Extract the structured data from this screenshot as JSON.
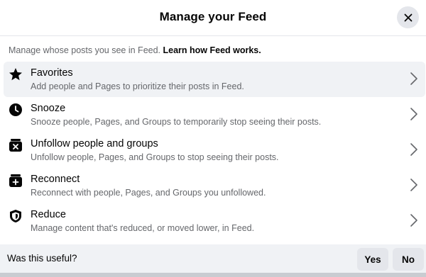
{
  "header": {
    "title": "Manage your Feed",
    "close_icon": "close-icon"
  },
  "intro": {
    "text": "Manage whose posts you see in Feed. ",
    "link": "Learn how Feed works."
  },
  "items": [
    {
      "icon": "star-icon",
      "title": "Favorites",
      "subtitle": "Add people and Pages to prioritize their posts in Feed."
    },
    {
      "icon": "clock-icon",
      "title": "Snooze",
      "subtitle": "Snooze people, Pages, and Groups to temporarily stop seeing their posts."
    },
    {
      "icon": "unfollow-icon",
      "title": "Unfollow people and groups",
      "subtitle": "Unfollow people, Pages, and Groups to stop seeing their posts."
    },
    {
      "icon": "reconnect-icon",
      "title": "Reconnect",
      "subtitle": "Reconnect with people, Pages, and Groups you unfollowed."
    },
    {
      "icon": "shield-icon",
      "title": "Reduce",
      "subtitle": "Manage content that's reduced, or moved lower, in Feed."
    }
  ],
  "footer": {
    "question": "Was this useful?",
    "yes": "Yes",
    "no": "No"
  },
  "colors": {
    "accent_bg": "#f0f2f5",
    "button_bg": "#e4e6eb",
    "secondary_text": "#65676b"
  }
}
